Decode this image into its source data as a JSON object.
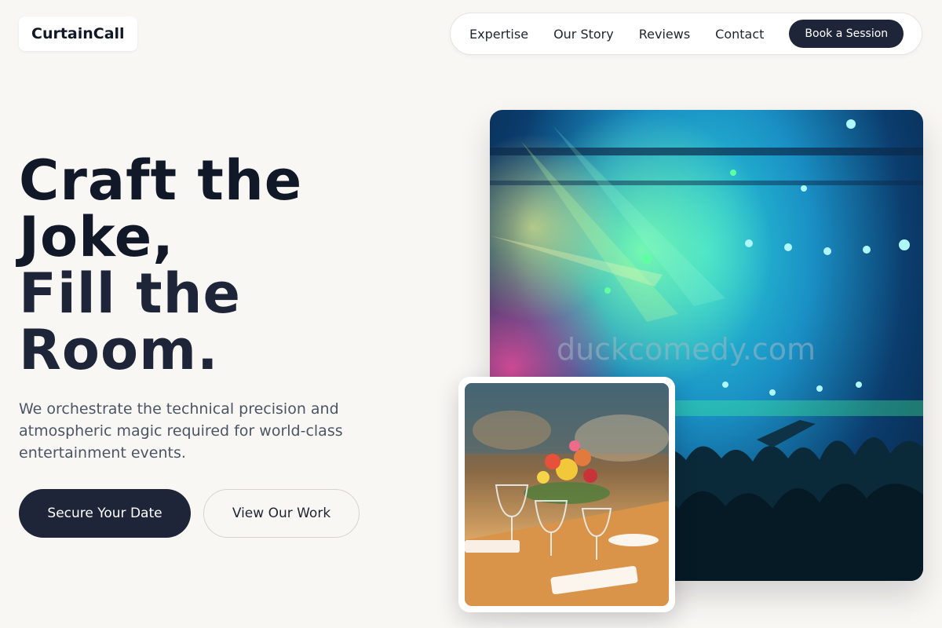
{
  "brand": {
    "name": "CurtainCall"
  },
  "nav": {
    "links": [
      "Expertise",
      "Our Story",
      "Reviews",
      "Contact"
    ],
    "cta": "Book a Session"
  },
  "hero": {
    "headline_lines": [
      "Craft the",
      "Joke,",
      "Fill the",
      "Room."
    ],
    "subtext": "We orchestrate the technical precision and atmospheric magic required for world-class entertainment events.",
    "primary_button": "Secure Your Date",
    "secondary_button": "View Our Work"
  },
  "images": {
    "main_watermark": "duckcomedy.com",
    "main_icon": "concert-crowd-photo",
    "secondary_icon": "banquet-table-photo"
  },
  "colors": {
    "background": "#f9f7f4",
    "primary": "#1e2538",
    "headline": "#111827",
    "body_text": "#4b5565"
  }
}
